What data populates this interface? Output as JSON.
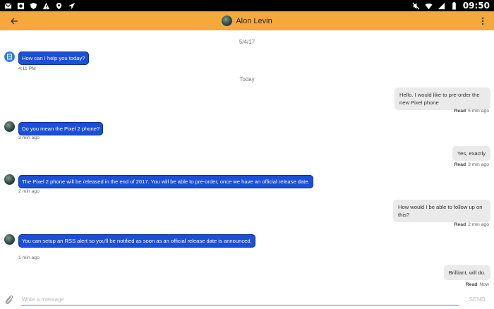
{
  "status_bar": {
    "time": "09:50",
    "left_icons": [
      "mail-icon",
      "image-icon",
      "shield-icon",
      "warning-icon",
      "location-icon",
      "nav-icon"
    ],
    "right_icons": [
      "mute-icon",
      "wifi-icon",
      "signal-icon",
      "battery-icon"
    ]
  },
  "app_bar": {
    "title": "Alon Levin",
    "back_icon": "arrow-left-icon",
    "menu_icon": "more-vertical-icon",
    "color": "#f4a93a"
  },
  "conversation": {
    "date_separators": [
      "5/4/17",
      "Today"
    ],
    "messages": [
      {
        "from": "bot",
        "text": "How can I help you today?",
        "meta": "4:11 PM"
      },
      {
        "from": "me",
        "text": "Hello. I would like to pre-order the new Pixel phone",
        "status": "Read",
        "time": "5 min ago"
      },
      {
        "from": "agent",
        "text": "Do you mean the Pixel 2 phone?",
        "meta": "3 min ago"
      },
      {
        "from": "me",
        "text": "Yes, exactly",
        "status": "Read",
        "time": "3 min ago"
      },
      {
        "from": "agent",
        "text": "The Pixel 2 phone will be released in the end of 2017. You will be able to pre-order, once we have an official release date.",
        "meta": "2 min ago"
      },
      {
        "from": "me",
        "text": "How would I be able to follow up on this?",
        "status": "Read",
        "time": "2 min ago"
      },
      {
        "from": "agent",
        "text": "You can setup an RSS alert so you'll be notified as soon as an official release date is announced.",
        "meta": "1 min ago"
      },
      {
        "from": "me",
        "text": "Brilliant,  will do.",
        "status": "Read",
        "time": "Now"
      }
    ],
    "incoming_color": "#1c4fd8",
    "outgoing_color": "#eaeaea"
  },
  "composer": {
    "placeholder": "Write a message",
    "value": "",
    "send_label": "SEND",
    "attach_icon": "paperclip-icon"
  }
}
